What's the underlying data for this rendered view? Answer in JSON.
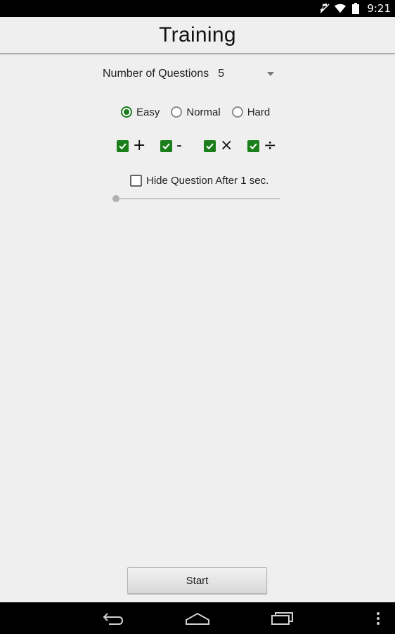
{
  "status_bar": {
    "time": "9:21",
    "icons": [
      "muted-icon",
      "wifi-icon",
      "battery-icon"
    ]
  },
  "header": {
    "title": "Training"
  },
  "questions": {
    "label": "Number of Questions",
    "selected_value": "5"
  },
  "difficulty": {
    "options": [
      {
        "label": "Easy",
        "checked": true
      },
      {
        "label": "Normal",
        "checked": false
      },
      {
        "label": "Hard",
        "checked": false
      }
    ]
  },
  "operators": [
    {
      "symbol": "+",
      "checked": true
    },
    {
      "symbol": "-",
      "checked": true
    },
    {
      "symbol": "×",
      "checked": true
    },
    {
      "symbol": "÷",
      "checked": true
    }
  ],
  "hide_question": {
    "label": "Hide Question After 1 sec.",
    "checked": false,
    "slider_value": 0
  },
  "start_button": {
    "label": "Start"
  },
  "colors": {
    "accent": "#1a7e1a",
    "background": "#efefef"
  },
  "nav_bar": {
    "buttons": [
      "back-icon",
      "home-icon",
      "recent-apps-icon",
      "menu-icon"
    ]
  }
}
